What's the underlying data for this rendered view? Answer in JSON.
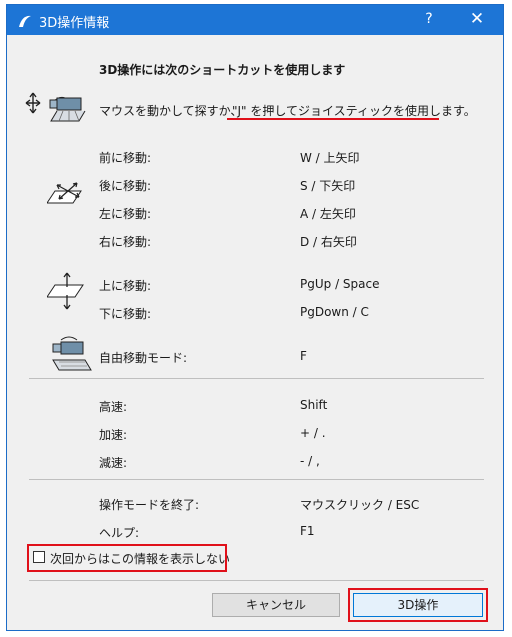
{
  "window": {
    "title": "3D操作情報",
    "help_label": "?",
    "close_label": "✕"
  },
  "heading": "3D操作には次のショートカットを使用します",
  "intro": {
    "text_plain": "マウスを動かして探すか、",
    "text_highlight": "\"J\" を押してジョイスティックを使用します。"
  },
  "movement_groups": [
    {
      "rows": [
        {
          "label": "前に移動:",
          "key": "W / 上矢印"
        },
        {
          "label": "後に移動:",
          "key": "S / 下矢印"
        },
        {
          "label": "左に移動:",
          "key": "A / 左矢印"
        },
        {
          "label": "右に移動:",
          "key": "D / 右矢印"
        }
      ]
    },
    {
      "rows": [
        {
          "label": "上に移動:",
          "key": "PgUp / Space"
        },
        {
          "label": "下に移動:",
          "key": "PgDown / C"
        }
      ]
    },
    {
      "rows": [
        {
          "label": "自由移動モード:",
          "key": "F"
        }
      ]
    }
  ],
  "speed_rows": [
    {
      "label": "高速:",
      "key": "Shift"
    },
    {
      "label": "加速:",
      "key": "+ / ."
    },
    {
      "label": "減速:",
      "key": "- / ,"
    }
  ],
  "exit_rows": [
    {
      "label": "操作モードを終了:",
      "key": "マウスクリック / ESC"
    },
    {
      "label": "ヘルプ:",
      "key": "F1"
    }
  ],
  "checkbox": {
    "label": "次回からはこの情報を表示しない",
    "checked": false
  },
  "buttons": {
    "cancel": "キャンセル",
    "confirm": "3D操作"
  },
  "colors": {
    "titlebar": "#1d75d6",
    "highlight": "#e0101a"
  },
  "icons": [
    "app-logo-icon",
    "orbit-camera-icon",
    "horizontal-move-icon",
    "vertical-move-icon",
    "free-move-camera-icon"
  ]
}
